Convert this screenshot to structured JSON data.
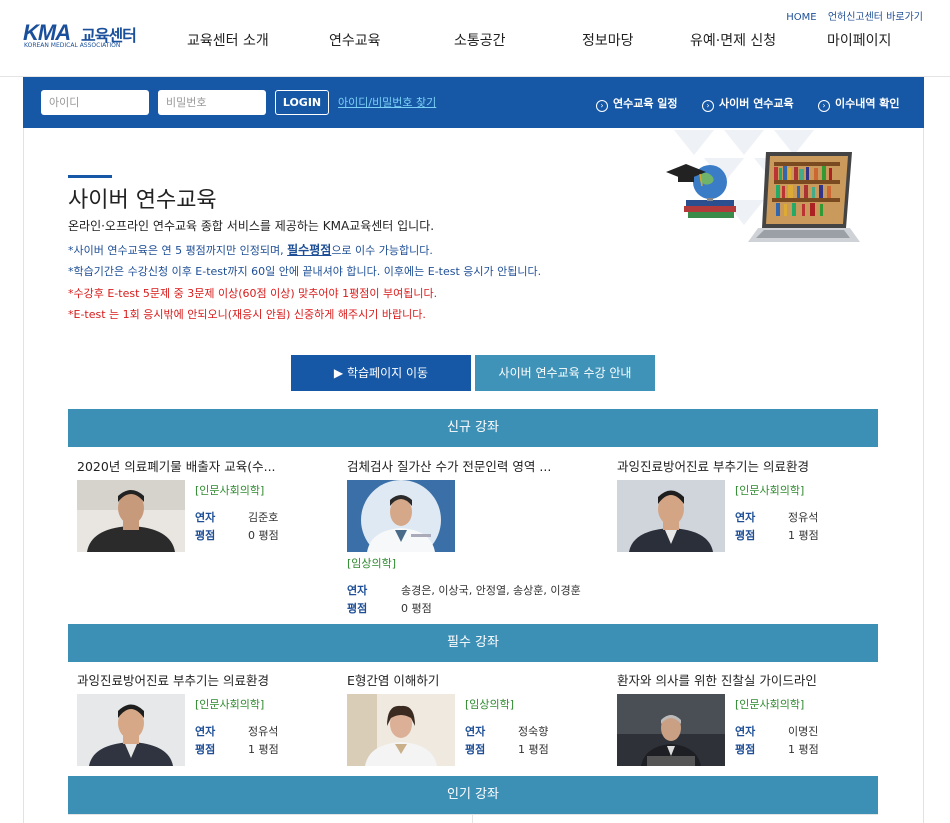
{
  "header": {
    "logo_mark": "KMA",
    "logo_text": "교육센터",
    "logo_sub": "KOREAN MEDICAL ASSOCIATION",
    "util_links": [
      "HOME",
      "언허신고센터 바로가기"
    ],
    "nav": [
      "교육센터 소개",
      "연수교육",
      "소통공간",
      "정보마당",
      "유예·면제 신청",
      "마이페이지"
    ]
  },
  "login": {
    "id_placeholder": "아이디",
    "pw_placeholder": "비밀번호",
    "login_label": "LOGIN",
    "find_label": "아이디/비밀번호 찾기",
    "quick_links": [
      "연수교육 일정",
      "사이버 연수교육",
      "이수내역 확인"
    ]
  },
  "intro": {
    "title": "사이버 연수교육",
    "desc": "온라인·오프라인 연수교육 종합 서비스를 제공하는 KMA교육센터 입니다.",
    "note1_pre": "*사이버 연수교육은 연 5 평점까지만 인정되며, ",
    "note1_em": "필수평점",
    "note1_post": "으로 이수 가능합니다.",
    "note2": "*학습기간은 수강신청 이후 E-test까지 60일 안에 끝내셔야 합니다. 이후에는 E-test 응시가 안됩니다.",
    "note3": "*수강후 E-test 5문제 중 3문제 이상(60점 이상) 맞추어야 1평점이 부여됩니다.",
    "note4": "*E-test 는 1회 응시밖에 안되오니(재응시 안됨) 신중하게 해주시기 바랍니다."
  },
  "buttons": {
    "learn": "▶ 학습페이지 이동",
    "guide": "사이버 연수교육 수강 안내"
  },
  "sections": {
    "new": "신규 강좌",
    "required": "필수 강좌",
    "popular": "인기 강좌"
  },
  "labels": {
    "lecturer": "연자",
    "rating": "평점"
  },
  "new_courses": [
    {
      "title": "2020년 의료폐기물 배출자 교육(수...",
      "category": "[인문사회의학]",
      "lecturer": "김준호",
      "rating": "0 평점"
    },
    {
      "title": "검체검사 질가산 수가 전문인력 영역 ...",
      "category": "[임상의학]",
      "lecturer": "송경은, 이상국, 안정열, 송상훈, 이경훈",
      "rating": "0 평점"
    },
    {
      "title": "과잉진료방어진료 부추기는 의료환경",
      "category": "[인문사회의학]",
      "lecturer": "정유석",
      "rating": "1 평점"
    }
  ],
  "required_courses": [
    {
      "title": "과잉진료방어진료 부추기는 의료환경",
      "category": "[인문사회의학]",
      "lecturer": "정유석",
      "rating": "1 평점"
    },
    {
      "title": "E형간염 이해하기",
      "category": "[임상의학]",
      "lecturer": "정숙향",
      "rating": "1 평점"
    },
    {
      "title": "환자와 의사를 위한 진찰실 가이드라인",
      "category": "[인문사회의학]",
      "lecturer": "이명진",
      "rating": "1 평점"
    }
  ],
  "colors": {
    "primary": "#1758a6",
    "section": "#3c8fb5",
    "category": "#2f8a2f",
    "warning": "#d81b1b"
  }
}
